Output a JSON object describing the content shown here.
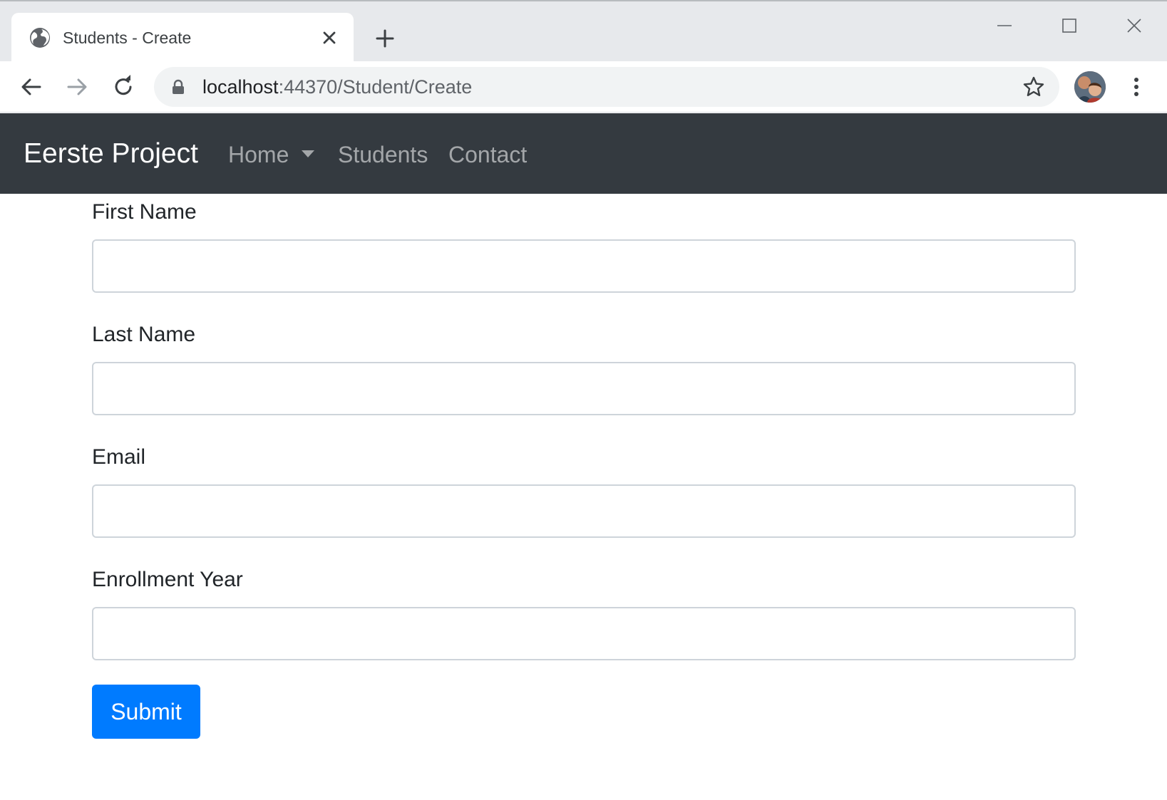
{
  "browser": {
    "tab": {
      "title": "Students - Create",
      "favicon": "globe-icon",
      "close_icon": "close-icon"
    },
    "new_tab_icon": "plus-icon",
    "window_controls": [
      "minimize-icon",
      "maximize-icon",
      "close-icon"
    ],
    "toolbar": {
      "back_icon": "arrow-left-icon",
      "forward_icon": "arrow-right-icon",
      "reload_icon": "reload-icon",
      "url_host": "localhost",
      "url_path": ":44370/Student/Create",
      "lock_icon": "lock-icon",
      "bookmark_icon": "star-icon",
      "profile": "avatar",
      "menu_icon": "kebab-menu-icon"
    }
  },
  "navbar": {
    "brand": "Eerste Project",
    "items": [
      {
        "label": "Home",
        "dropdown": true
      },
      {
        "label": "Students"
      },
      {
        "label": "Contact"
      }
    ]
  },
  "form": {
    "fields": [
      {
        "label": "First Name",
        "value": ""
      },
      {
        "label": "Last Name",
        "value": ""
      },
      {
        "label": "Email",
        "value": ""
      },
      {
        "label": "Enrollment Year",
        "value": ""
      }
    ],
    "submit_label": "Submit"
  },
  "colors": {
    "navbar_bg": "#343a40",
    "primary": "#007bff",
    "tabstrip_bg": "#e7e9ec"
  }
}
